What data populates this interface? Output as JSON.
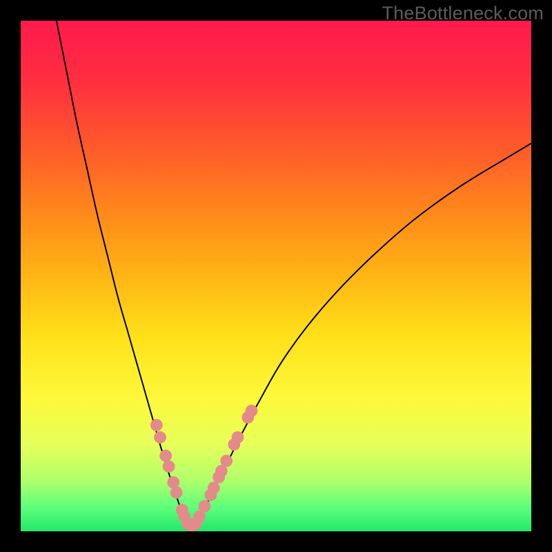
{
  "watermark": "TheBottleneck.com",
  "gradient": {
    "stops": [
      {
        "offset": 0.0,
        "color": "#ff1a4d"
      },
      {
        "offset": 0.12,
        "color": "#ff2f3f"
      },
      {
        "offset": 0.25,
        "color": "#ff5a2a"
      },
      {
        "offset": 0.38,
        "color": "#ff8a1a"
      },
      {
        "offset": 0.5,
        "color": "#ffb514"
      },
      {
        "offset": 0.62,
        "color": "#ffe11a"
      },
      {
        "offset": 0.74,
        "color": "#fdf93a"
      },
      {
        "offset": 0.83,
        "color": "#e6ff5a"
      },
      {
        "offset": 0.9,
        "color": "#b0ff6a"
      },
      {
        "offset": 0.955,
        "color": "#5aff7a"
      },
      {
        "offset": 1.0,
        "color": "#22e86a"
      }
    ]
  },
  "chart_data": {
    "type": "line",
    "title": "",
    "xlabel": "",
    "ylabel": "",
    "xlim": [
      0,
      100
    ],
    "ylim": [
      0,
      100
    ],
    "series": [
      {
        "name": "left-curve",
        "x": [
          7,
          9,
          11,
          13,
          15,
          17,
          19,
          21,
          23,
          25,
          27,
          28.8,
          30.3,
          31.5,
          32.5,
          33.3
        ],
        "y": [
          100,
          90,
          80,
          71,
          62,
          54,
          46,
          39,
          32,
          25,
          18,
          12,
          7.5,
          4.0,
          2.0,
          1.0
        ]
      },
      {
        "name": "right-curve",
        "x": [
          33.3,
          34.5,
          36,
          38,
          40.5,
          43.5,
          47,
          51,
          56,
          62,
          69,
          77,
          86,
          95,
          100
        ],
        "y": [
          1.0,
          2.0,
          4.5,
          8.5,
          13.5,
          19.5,
          26,
          33,
          40,
          47,
          54,
          61,
          67.5,
          73,
          76
        ]
      }
    ],
    "highlight_points": {
      "color": "#e58a8a",
      "radius": 1.2,
      "points": [
        {
          "x": 26.6,
          "y": 20.8
        },
        {
          "x": 27.3,
          "y": 18.4
        },
        {
          "x": 28.4,
          "y": 14.8
        },
        {
          "x": 29.0,
          "y": 12.7
        },
        {
          "x": 29.9,
          "y": 9.6
        },
        {
          "x": 30.5,
          "y": 7.6
        },
        {
          "x": 31.6,
          "y": 4.2
        },
        {
          "x": 32.0,
          "y": 3.0
        },
        {
          "x": 32.7,
          "y": 1.5
        },
        {
          "x": 33.5,
          "y": 1.0
        },
        {
          "x": 34.3,
          "y": 1.5
        },
        {
          "x": 35.0,
          "y": 2.9
        },
        {
          "x": 36.0,
          "y": 4.9
        },
        {
          "x": 37.2,
          "y": 7.1
        },
        {
          "x": 37.8,
          "y": 8.5
        },
        {
          "x": 38.8,
          "y": 10.6
        },
        {
          "x": 39.3,
          "y": 11.8
        },
        {
          "x": 40.3,
          "y": 13.8
        },
        {
          "x": 41.8,
          "y": 17.0
        },
        {
          "x": 42.5,
          "y": 18.4
        },
        {
          "x": 44.5,
          "y": 22.3
        },
        {
          "x": 45.2,
          "y": 23.6
        }
      ]
    }
  }
}
